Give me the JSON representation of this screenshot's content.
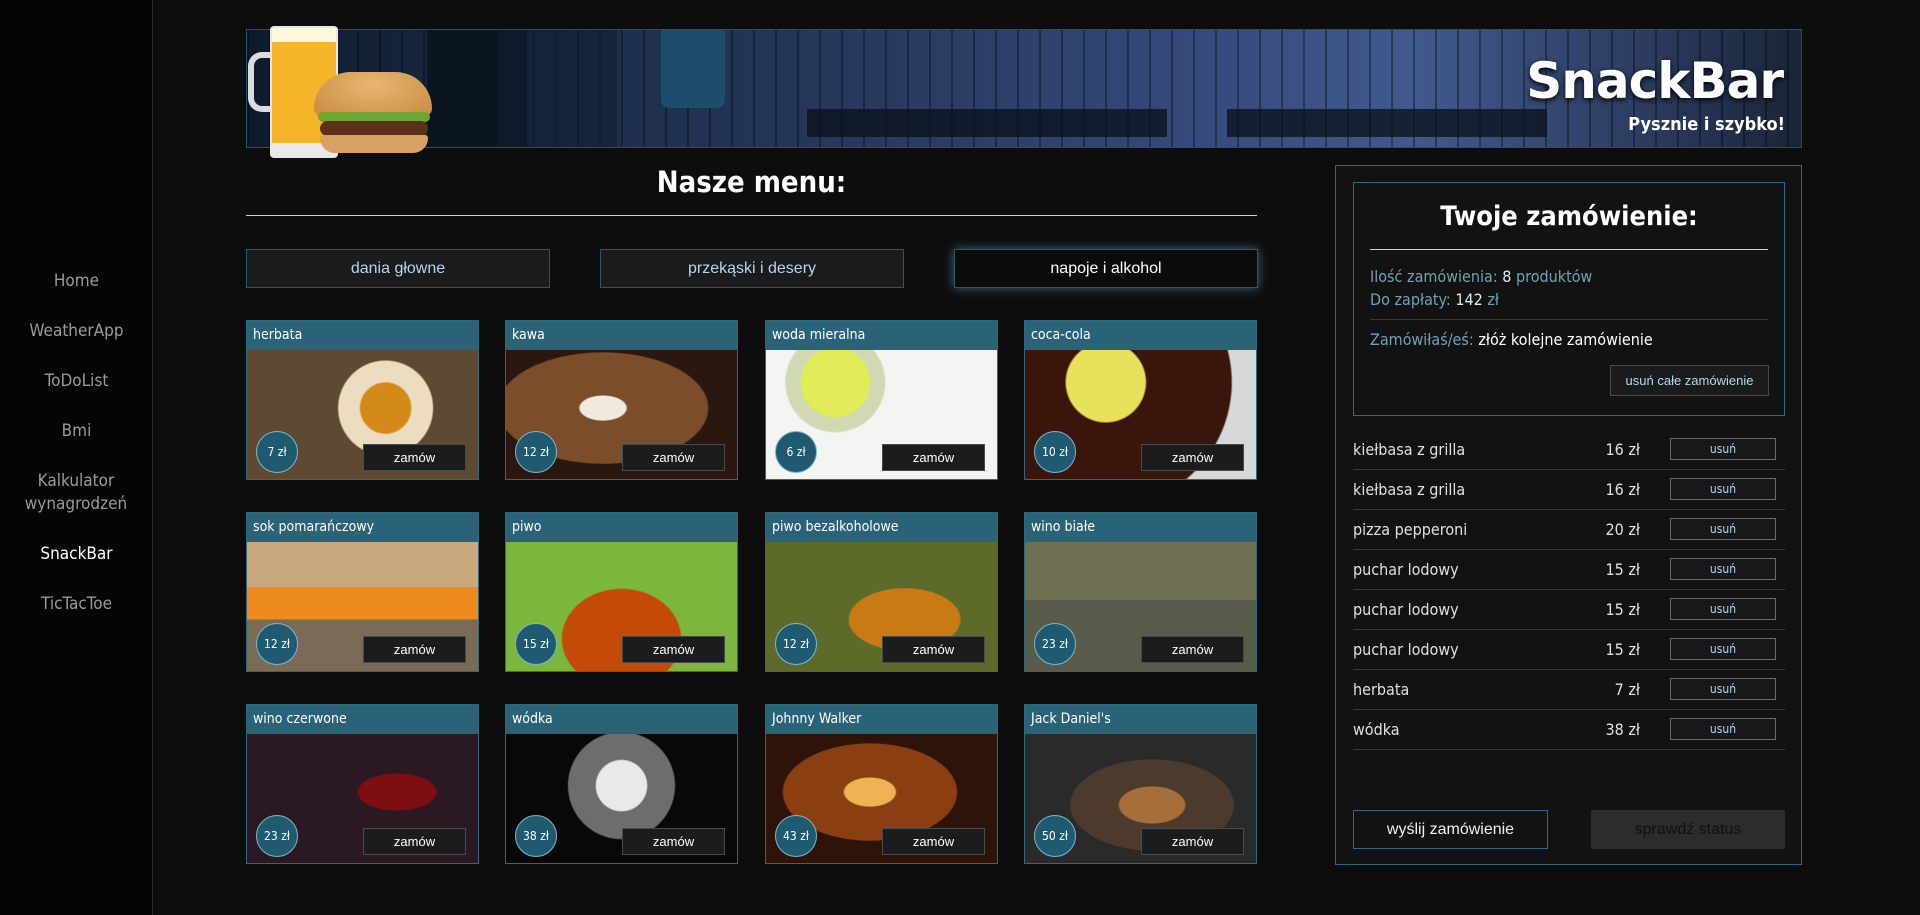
{
  "sidebar": {
    "items": [
      {
        "label": "Home"
      },
      {
        "label": "WeatherApp"
      },
      {
        "label": "ToDoList"
      },
      {
        "label": "Bmi"
      },
      {
        "label": "Kalkulator wynagrodzeń"
      },
      {
        "label": "SnackBar"
      },
      {
        "label": "TicTacToe"
      }
    ],
    "active": "SnackBar"
  },
  "header": {
    "brand": "SnackBar",
    "tagline": "Pysznie i szybko!"
  },
  "menu": {
    "title": "Nasze menu:",
    "categories": [
      {
        "label": "dania głowne"
      },
      {
        "label": "przekąski i desery"
      },
      {
        "label": "napoje i alkohol"
      }
    ],
    "active_category": "napoje i alkohol",
    "order_label": "zamów",
    "items": [
      {
        "name": "herbata",
        "price": "7 zł"
      },
      {
        "name": "kawa",
        "price": "12 zł"
      },
      {
        "name": "woda mieralna",
        "price": "6 zł"
      },
      {
        "name": "coca-cola",
        "price": "10 zł"
      },
      {
        "name": "sok pomarańczowy",
        "price": "12 zł"
      },
      {
        "name": "piwo",
        "price": "15 zł"
      },
      {
        "name": "piwo bezalkoholowe",
        "price": "12 zł"
      },
      {
        "name": "wino białe",
        "price": "23 zł"
      },
      {
        "name": "wino czerwone",
        "price": "23 zł"
      },
      {
        "name": "wódka",
        "price": "38 zł"
      },
      {
        "name": "Johnny Walker",
        "price": "43 zł"
      },
      {
        "name": "Jack Daniel's",
        "price": "50 zł"
      }
    ]
  },
  "order": {
    "heading": "Twoje zamówienie:",
    "count_label": "Ilość zamówienia:",
    "count_value": "8",
    "count_unit": "produktów",
    "total_label": "Do zapłaty:",
    "total_value": "142",
    "total_unit": "zł",
    "again_label": "Zamówiłaś/eś:",
    "again_link": "złóż kolejne zamówienie",
    "clear_label": "usuń całe zamówienie",
    "remove_label": "usuń",
    "items": [
      {
        "name": "kiełbasa z grilla",
        "price": "16 zł"
      },
      {
        "name": "kiełbasa z grilla",
        "price": "16 zł"
      },
      {
        "name": "pizza pepperoni",
        "price": "20 zł"
      },
      {
        "name": "puchar lodowy",
        "price": "15 zł"
      },
      {
        "name": "puchar lodowy",
        "price": "15 zł"
      },
      {
        "name": "puchar lodowy",
        "price": "15 zł"
      },
      {
        "name": "herbata",
        "price": "7 zł"
      },
      {
        "name": "wódka",
        "price": "38 zł"
      }
    ],
    "send_label": "wyślij zamówienie",
    "status_label": "sprawdź status"
  }
}
